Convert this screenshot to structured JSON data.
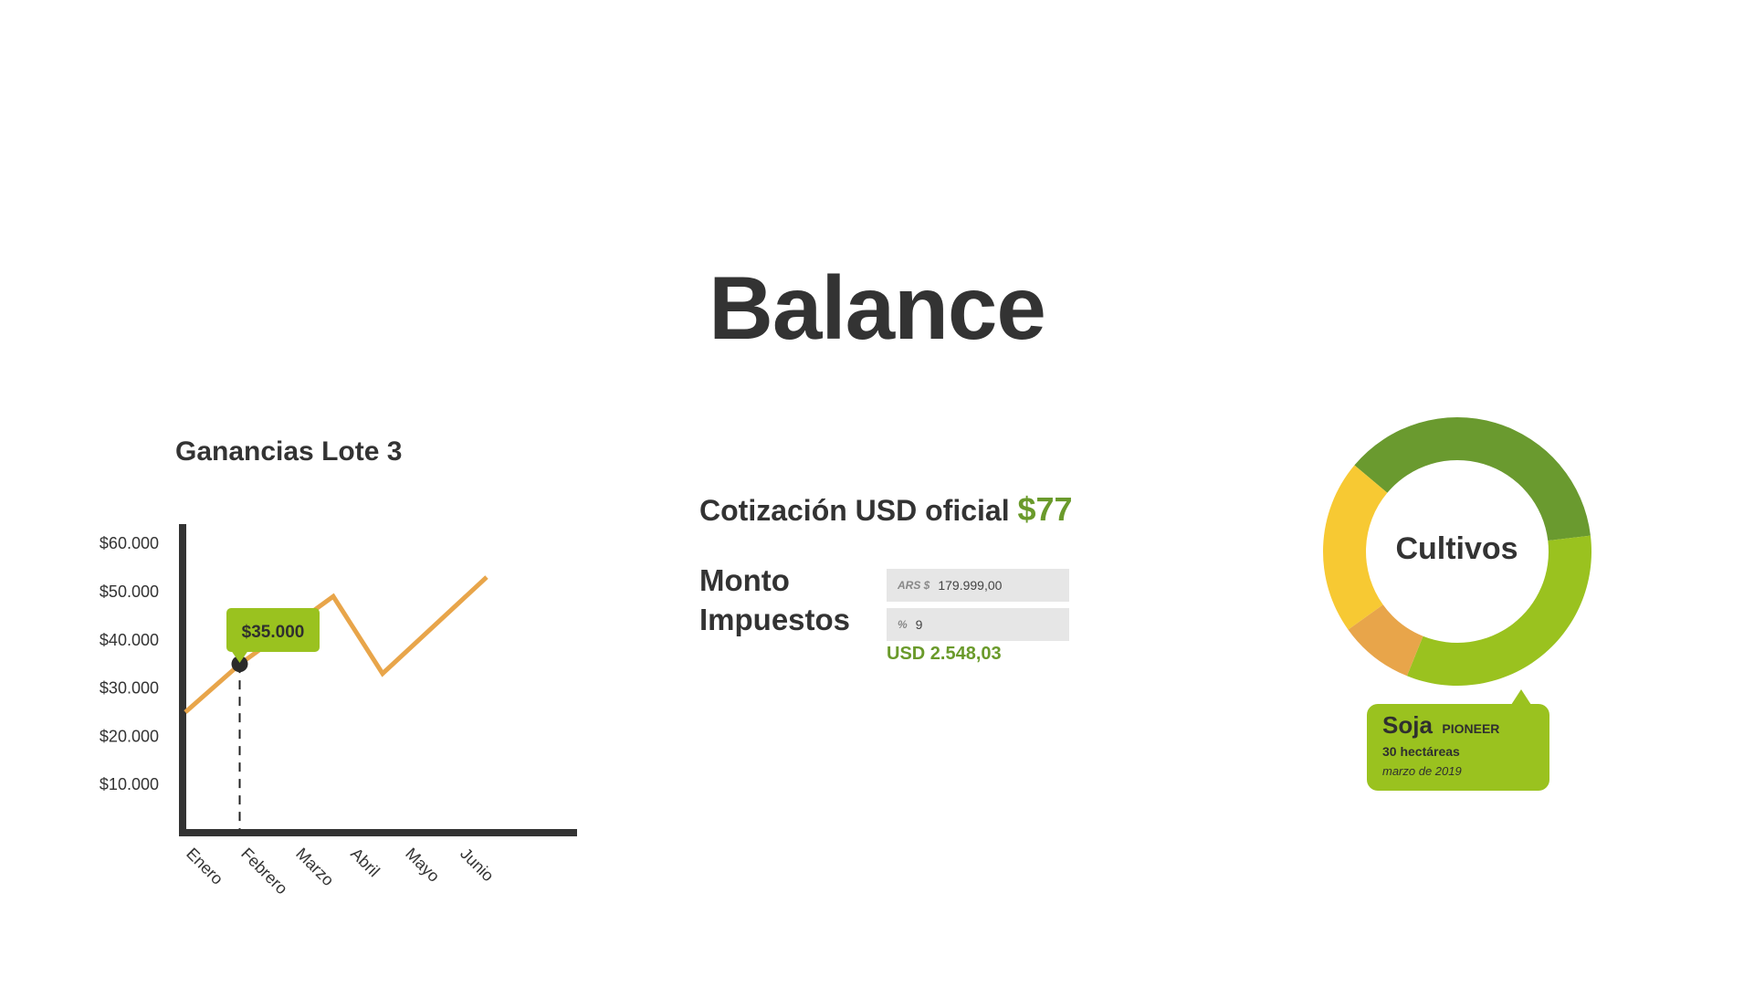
{
  "page": {
    "title": "Balance"
  },
  "earnings": {
    "title": "Ganancias Lote 3",
    "tooltip": "$35.000",
    "colors": {
      "line": "#e8a54a",
      "axis": "#333333",
      "tooltip": "#9ac21f"
    }
  },
  "exchange": {
    "label": "Cotización USD oficial",
    "value": "$77",
    "amount_label": "Monto",
    "tax_label": "Impuestos",
    "amount_prefix": "ARS $",
    "amount_value": "179.999,00",
    "tax_prefix": "%",
    "tax_value": "9",
    "result": "USD 2.548,03",
    "accent_color": "#6a9a2b"
  },
  "crops": {
    "title": "Cultivos",
    "callout": {
      "name": "Soja",
      "brand": "PIONEER",
      "area": "30 hectáreas",
      "date": "marzo de 2019"
    }
  },
  "chart_data": [
    {
      "type": "line",
      "title": "Ganancias Lote 3",
      "categories": [
        "Enero",
        "Febrero",
        "Marzo",
        "Abril",
        "Mayo",
        "Junio"
      ],
      "y_ticks": [
        10000,
        20000,
        30000,
        40000,
        50000,
        60000
      ],
      "y_tick_labels": [
        "$10.000",
        "$20.000",
        "$30.000",
        "$40.000",
        "$50.000",
        "$60.000"
      ],
      "ylim": [
        0,
        64000
      ],
      "series": [
        {
          "x": [
            0,
            1,
            2.7,
            3.6,
            5.5
          ],
          "values": [
            25000,
            35000,
            49000,
            33000,
            53000
          ],
          "color": "#e8a54a"
        }
      ],
      "highlight": {
        "category": "Febrero",
        "value": 35000,
        "label": "$35.000"
      },
      "grid": false
    },
    {
      "type": "pie",
      "donut": true,
      "center_label": "Cultivos",
      "start_angle_deg": -140,
      "values": [
        37,
        33,
        9,
        21
      ],
      "colors": [
        "#6a9a2f",
        "#9ac21f",
        "#e8a54a",
        "#f7c933"
      ]
    }
  ]
}
